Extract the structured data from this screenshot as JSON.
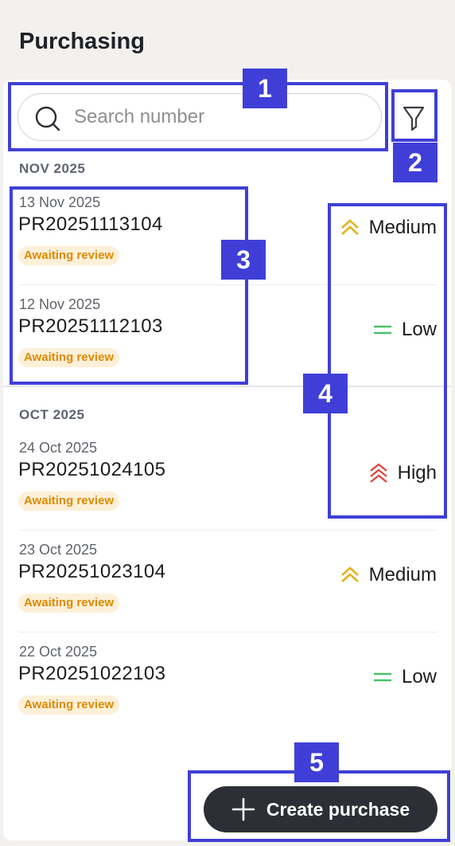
{
  "header": {
    "title": "Purchasing"
  },
  "search": {
    "placeholder": "Search number",
    "value": ""
  },
  "filter": {
    "icon": "filter-icon"
  },
  "groups": [
    {
      "label": "NOV 2025",
      "items": [
        {
          "date": "13 Nov 2025",
          "number": "PR20251113104",
          "status": "Awaiting review",
          "priority": "Medium"
        },
        {
          "date": "12 Nov 2025",
          "number": "PR20251112103",
          "status": "Awaiting review",
          "priority": "Low"
        }
      ]
    },
    {
      "label": "OCT 2025",
      "items": [
        {
          "date": "24 Oct 2025",
          "number": "PR20251024105",
          "status": "Awaiting review",
          "priority": "High"
        },
        {
          "date": "23 Oct 2025",
          "number": "PR20251023104",
          "status": "Awaiting review",
          "priority": "Medium"
        },
        {
          "date": "22 Oct 2025",
          "number": "PR20251022103",
          "status": "Awaiting review",
          "priority": "Low"
        }
      ]
    }
  ],
  "priority_colors": {
    "High": "#e0453f",
    "Medium": "#e4b21c",
    "Low": "#4cc06a"
  },
  "status_colors": {
    "badge_bg": "#fdf0d8",
    "badge_text": "#de8a00"
  },
  "fab": {
    "label": "Create purchase",
    "icon": "plus-icon"
  },
  "annotations": [
    "1",
    "2",
    "3",
    "4",
    "5"
  ],
  "annotation_color": "#3f3fd8"
}
